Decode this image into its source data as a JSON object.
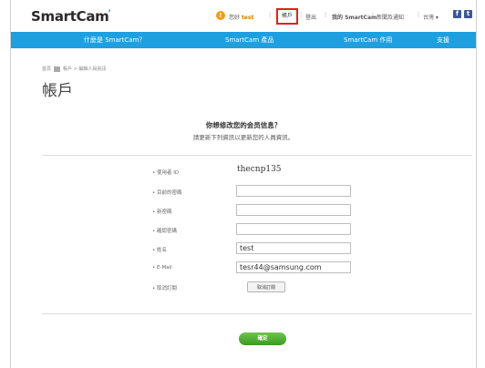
{
  "header": {
    "logo": "SmartCam",
    "logo_mark": "’",
    "util_links": {
      "hello_prefix": "您好",
      "user": "test",
      "account": "帳戶",
      "logout": "登出",
      "newsletter": "我的 SmartCam",
      "news": "新聞及通知",
      "region": "台灣 ▾"
    }
  },
  "nav": {
    "items": [
      "什麼是 SmartCam？",
      "SmartCam 產品",
      "SmartCam 作用",
      "支援"
    ]
  },
  "breadcrumb": {
    "home": "首頁",
    "path": "帳戶 > 編輯人員資訊"
  },
  "page": {
    "title": "帳戶",
    "question": "你想修改您的会员信息？",
    "subtitle": "請更新下列資訊以更新您的人員資訊。"
  },
  "form": {
    "user_id_label": "• 使用者 ID",
    "user_id_value": "thecnp135",
    "current_pw_label": "• 目前的密碼",
    "new_pw_label": "• 新密碼",
    "confirm_pw_label": "• 確認密碼",
    "name_label": "• 姓名",
    "name_value": "test",
    "email_label": "• E-Mail",
    "email_value": "tesr44@samsung.com",
    "unsubscribe_label": "• 取消訂閱",
    "unsubscribe_button": "取消訂閱"
  },
  "actions": {
    "confirm": "確定"
  },
  "colors": {
    "nav_blue": "#1ea0e0",
    "highlight_red": "#e02020",
    "confirm_green": "#4cae2e"
  }
}
